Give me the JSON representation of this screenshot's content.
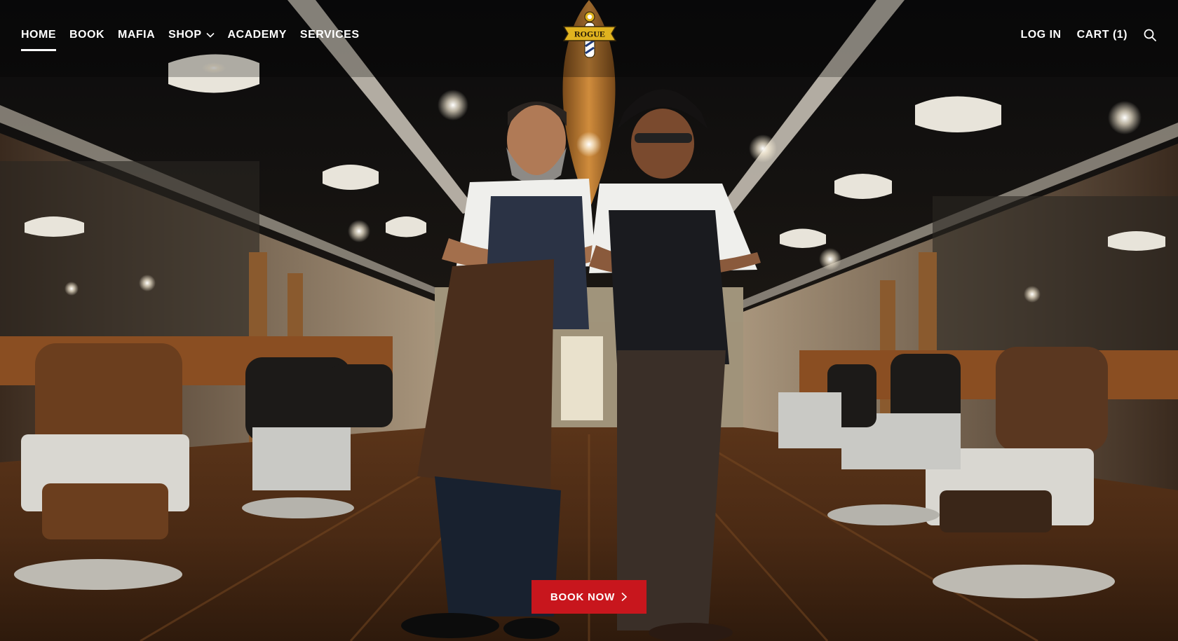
{
  "nav": {
    "left": [
      {
        "label": "HOME",
        "active": true
      },
      {
        "label": "BOOK"
      },
      {
        "label": "MAFIA"
      },
      {
        "label": "SHOP",
        "dropdown": true
      },
      {
        "label": "ACADEMY"
      },
      {
        "label": "SERVICES"
      }
    ],
    "login_label": "LOG IN",
    "cart_label": "CART (1)"
  },
  "logo": {
    "text": "ROGUE"
  },
  "hero": {
    "cta_label": "BOOK NOW"
  },
  "colors": {
    "accent": "#c8161d",
    "nav_text": "#ffffff",
    "logo_gold": "#e0b31f"
  },
  "icons": {
    "search": "search-icon",
    "dropdown": "chevron-down-icon",
    "cta_arrow": "chevron-right-icon"
  }
}
